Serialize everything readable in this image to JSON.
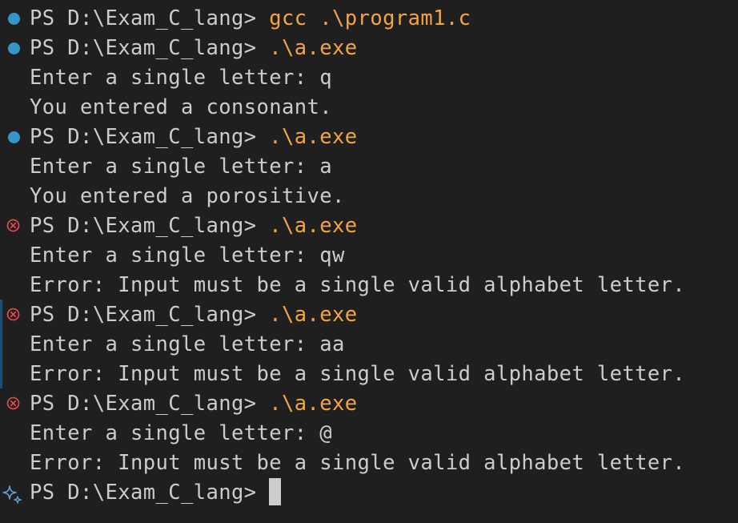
{
  "terminal": {
    "prompt": "PS D:\\Exam_C_lang> ",
    "commands": [
      {
        "status": "success",
        "cmd": "gcc .\\program1.c",
        "output": []
      },
      {
        "status": "success",
        "cmd": ".\\a.exe",
        "output": [
          "Enter a single letter: q",
          "You entered a consonant."
        ]
      },
      {
        "status": "success",
        "cmd": ".\\a.exe",
        "output": [
          "Enter a single letter: a",
          "You entered a porositive."
        ]
      },
      {
        "status": "error",
        "cmd": ".\\a.exe",
        "output": [
          "Enter a single letter: qw",
          "Error: Input must be a single valid alphabet letter."
        ]
      },
      {
        "status": "error",
        "cmd": ".\\a.exe",
        "output": [
          "Enter a single letter: aa",
          "Error: Input must be a single valid alphabet letter."
        ]
      },
      {
        "status": "error",
        "cmd": ".\\a.exe",
        "output": [
          "Enter a single letter: @",
          "Error: Input must be a single valid alphabet letter."
        ]
      }
    ],
    "current_prompt_icon": "sparkle-icon",
    "colors": {
      "background": "#1f1f1f",
      "text": "#cccccc",
      "command": "#f5a442",
      "success_dot": "#3794c8",
      "error_icon": "#f14c4c"
    }
  }
}
